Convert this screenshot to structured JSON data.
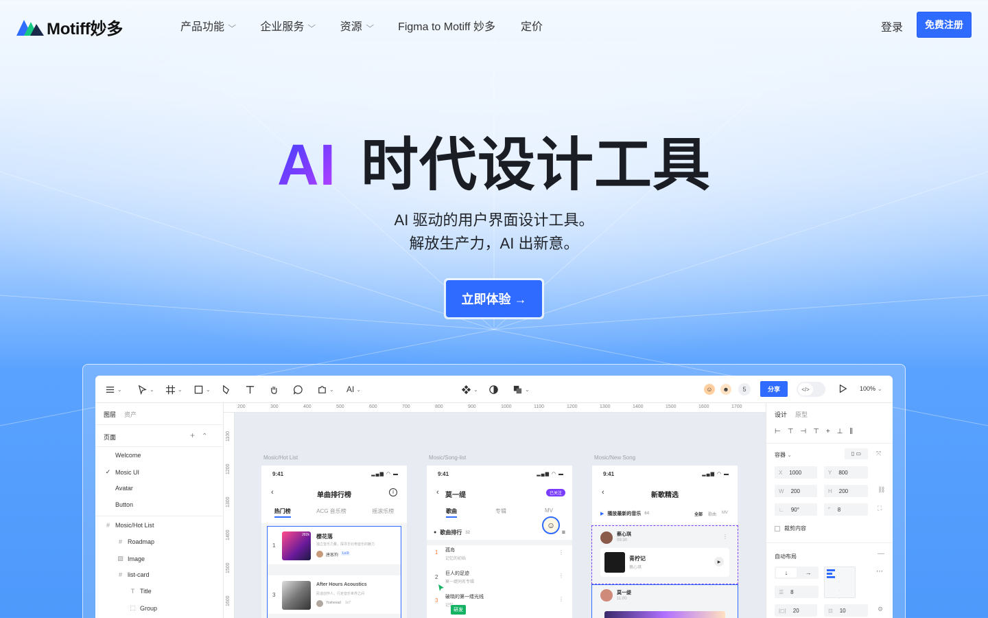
{
  "header": {
    "logo_text": "Motiff妙多",
    "nav": [
      {
        "label": "产品功能",
        "has_dropdown": true
      },
      {
        "label": "企业服务",
        "has_dropdown": true
      },
      {
        "label": "资源",
        "has_dropdown": true
      },
      {
        "label": "Figma to Motiff 妙多",
        "has_dropdown": false
      },
      {
        "label": "定价",
        "has_dropdown": false
      }
    ],
    "login_label": "登录",
    "signup_label": "免费注册"
  },
  "hero": {
    "title_ai": "AI",
    "title_rest": "时代设计工具",
    "subtitle_line1": "AI 驱动的用户界面设计工具。",
    "subtitle_line2": "解放生产力，AI 出新意。",
    "cta_label": "立即体验 →"
  },
  "colors": {
    "accent": "#2f6bff",
    "title_gradient_start": "#3a42ff",
    "title_gradient_end": "#c040ff"
  },
  "editor": {
    "toolbar": {
      "ai_label": "AI",
      "collaborator_count": "5",
      "share_label": "分享",
      "dev_mode_icon": "code-icon",
      "zoom": "100%"
    },
    "left_panel": {
      "tabs": [
        "图层",
        "资产"
      ],
      "pages_header": "页面",
      "pages": [
        {
          "label": "Welcome",
          "checked": false
        },
        {
          "label": "Mosic UI",
          "checked": true
        },
        {
          "label": "Avatar",
          "checked": false
        },
        {
          "label": "Button",
          "checked": false
        }
      ],
      "layers": [
        {
          "label": "Mosic/Hot List",
          "icon": "frame-icon"
        },
        {
          "label": "Roadmap",
          "icon": "frame-icon"
        },
        {
          "label": "Image",
          "icon": "image-icon"
        },
        {
          "label": "list-card",
          "icon": "frame-icon"
        },
        {
          "label": "Title",
          "icon": "text-icon"
        },
        {
          "label": "Group",
          "icon": "group-icon"
        }
      ]
    },
    "ruler_h": [
      "200",
      "300",
      "400",
      "500",
      "600",
      "700",
      "800",
      "900",
      "1000",
      "1100",
      "1200",
      "1300",
      "1400",
      "1500",
      "1600",
      "1700"
    ],
    "ruler_v": [
      "1100",
      "1200",
      "1300",
      "1400",
      "1500",
      "1600"
    ],
    "frames": [
      {
        "label": "Mosic/Hot List",
        "time": "9:41",
        "title": "单曲排行榜",
        "tabs": [
          "热门榜",
          "ACG 音乐榜",
          "摇滚乐榜"
        ],
        "items": [
          {
            "rank": "1",
            "name": "樱花落",
            "desc": "独立音乐力量，探寻华北电音乐的魅力",
            "author": "唐客狗",
            "badge": "Lv.9",
            "plays": "282k"
          },
          {
            "rank": "3",
            "name": "After Hours Acoustics",
            "desc": "民谣创作人，行走音乐世界之间",
            "author": "Yoshevad",
            "badge": "1x7"
          }
        ]
      },
      {
        "label": "Mosic/Song-list",
        "time": "9:41",
        "title": "莫一缇",
        "follow": "已关注",
        "tabs": [
          "歌曲",
          "专辑",
          "MV"
        ],
        "section": "歌曲排行",
        "section_count": "32",
        "items": [
          {
            "rank": "1",
            "name": "孤岛",
            "desc": "记忆的初始"
          },
          {
            "rank": "2",
            "name": "巨人的足迹",
            "desc": "莫一缇同名专辑"
          },
          {
            "rank": "3",
            "name": "破晓的第一缕光线",
            "desc": "记忆..."
          }
        ],
        "cursor_tag": "研发"
      },
      {
        "label": "Mosic/New Song",
        "time": "9:41",
        "title": "新歌精选",
        "section": "播放最新的音乐",
        "section_count": "64",
        "filters": [
          "全部",
          "歌曲",
          "MV"
        ],
        "items": [
          {
            "user": "蔡心琪",
            "time": "09:30",
            "song": "青柠记",
            "artist": "蔡心琪"
          },
          {
            "user": "莫一缇",
            "time": "11:00"
          }
        ]
      }
    ],
    "right_panel": {
      "tabs": [
        "设计",
        "原型"
      ],
      "container_label": "容器",
      "x": "1000",
      "y": "800",
      "w": "200",
      "h": "200",
      "rotation": "90°",
      "radius": "8",
      "clip_label": "裁剪内容",
      "auto_layout_label": "自动布局",
      "gap": "8",
      "padding_h": "20",
      "padding_v": "10"
    }
  }
}
